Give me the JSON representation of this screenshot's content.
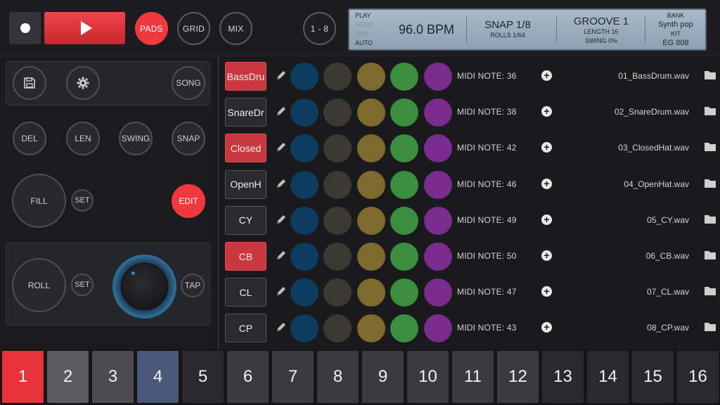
{
  "transport": {
    "record_label": "",
    "play_label": ""
  },
  "modes": {
    "pads": "PADS",
    "grid": "GRID",
    "mix": "MIX",
    "bank_range": "1 - 8"
  },
  "lcd": {
    "status": [
      "PLAY",
      "SONG",
      "LINK",
      "AUTO"
    ],
    "bpm": "96.0 BPM",
    "snap": "SNAP 1/8",
    "rolls": "ROLLS 1/64",
    "groove": "GROOVE 1",
    "length": "LENGTH 16",
    "swing": "SWING 0%",
    "bank_label": "BANK",
    "bank_value": "Synth pop",
    "kit_label": "KIT",
    "kit_value": "EG 808"
  },
  "left": {
    "song": "SONG",
    "del": "DEL",
    "len": "LEN",
    "swing": "SWING",
    "snap": "SNAP",
    "fill": "FILL",
    "fill_set": "SET",
    "edit": "EDIT",
    "roll": "ROLL",
    "roll_set": "SET",
    "tap": "TAP"
  },
  "tracks": [
    {
      "name": "BassDru",
      "style": "red",
      "midi": "MIDI NOTE: 36",
      "file": "01_BassDrum.wav"
    },
    {
      "name": "SnareDr",
      "style": "dark",
      "midi": "MIDI NOTE: 38",
      "file": "02_SnareDrum.wav"
    },
    {
      "name": "Closed",
      "style": "red",
      "midi": "MIDI NOTE: 42",
      "file": "03_ClosedHat.wav"
    },
    {
      "name": "OpenH",
      "style": "dark",
      "midi": "MIDI NOTE: 46",
      "file": "04_OpenHat.wav"
    },
    {
      "name": "CY",
      "style": "dark",
      "midi": "MIDI NOTE: 49",
      "file": "05_CY.wav"
    },
    {
      "name": "CB",
      "style": "red",
      "midi": "MIDI NOTE: 50",
      "file": "06_CB.wav"
    },
    {
      "name": "CL",
      "style": "dark",
      "midi": "MIDI NOTE: 47",
      "file": "07_CL.wav"
    },
    {
      "name": "CP",
      "style": "dark",
      "midi": "MIDI NOTE: 43",
      "file": "08_CP.wav"
    }
  ],
  "dot_colors": [
    "#0d3d5e",
    "#3a3a33",
    "#7e6a2e",
    "#3a8e3e",
    "#7a2c8e"
  ],
  "pads": [
    {
      "label": "1",
      "color": "#e8323a"
    },
    {
      "label": "2",
      "color": "#5b5b60"
    },
    {
      "label": "3",
      "color": "#4b4b50"
    },
    {
      "label": "4",
      "color": "#4a5778"
    },
    {
      "label": "5",
      "color": "#2a2a2e"
    },
    {
      "label": "6",
      "color": "#3a3a3f"
    },
    {
      "label": "7",
      "color": "#3a3a3f"
    },
    {
      "label": "8",
      "color": "#3a3a3f"
    },
    {
      "label": "9",
      "color": "#3a3a3f"
    },
    {
      "label": "10",
      "color": "#3a3a3f"
    },
    {
      "label": "11",
      "color": "#3a3a3f"
    },
    {
      "label": "12",
      "color": "#3a3a3f"
    },
    {
      "label": "13",
      "color": "#2a2a2e"
    },
    {
      "label": "14",
      "color": "#2a2a2e"
    },
    {
      "label": "15",
      "color": "#2a2a2e"
    },
    {
      "label": "16",
      "color": "#2a2a2e"
    }
  ]
}
